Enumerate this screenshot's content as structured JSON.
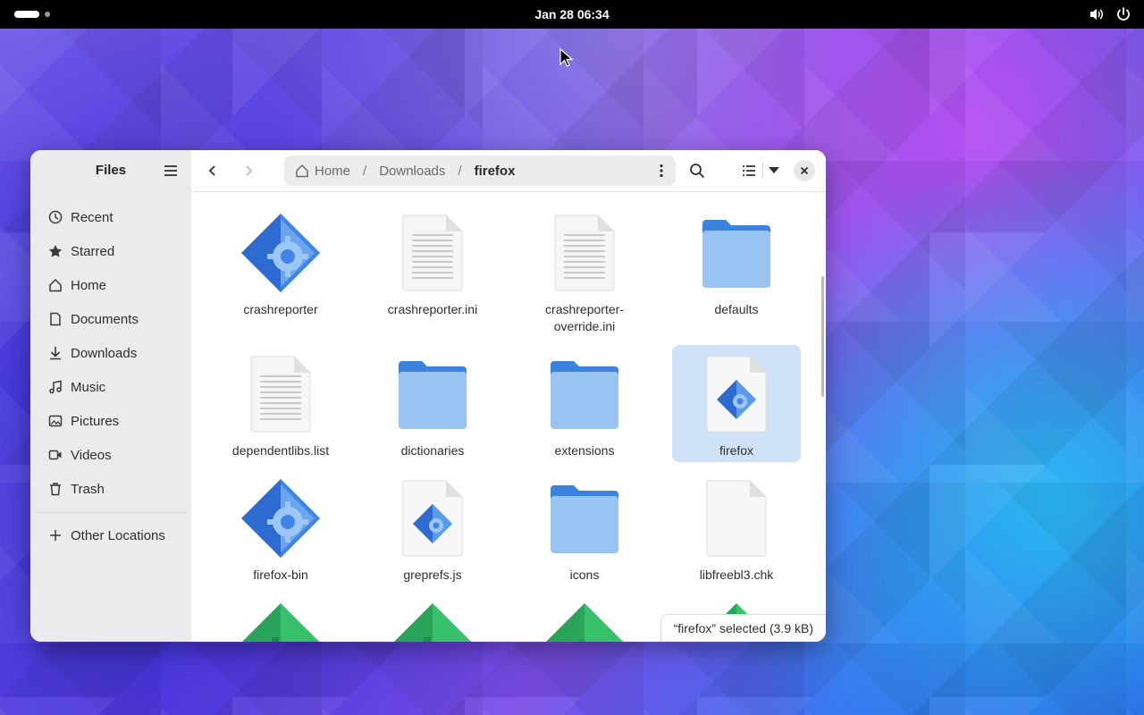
{
  "topbar": {
    "clock": "Jan 28  06:34"
  },
  "window": {
    "sidebar": {
      "title": "Files",
      "places": [
        {
          "label": "Recent",
          "icon": "clock-icon"
        },
        {
          "label": "Starred",
          "icon": "star-icon"
        },
        {
          "label": "Home",
          "icon": "home-icon"
        },
        {
          "label": "Documents",
          "icon": "document-icon"
        },
        {
          "label": "Downloads",
          "icon": "download-icon"
        },
        {
          "label": "Music",
          "icon": "music-icon"
        },
        {
          "label": "Pictures",
          "icon": "picture-icon"
        },
        {
          "label": "Videos",
          "icon": "video-icon"
        },
        {
          "label": "Trash",
          "icon": "trash-icon"
        }
      ],
      "other_locations": "Other Locations"
    },
    "pathbar": {
      "crumbs": [
        "Home",
        "Downloads",
        "firefox"
      ]
    },
    "files": [
      {
        "name": "crashreporter",
        "type": "executable"
      },
      {
        "name": "crashreporter.ini",
        "type": "text"
      },
      {
        "name": "crashreporter-override.ini",
        "type": "text"
      },
      {
        "name": "defaults",
        "type": "folder"
      },
      {
        "name": "dependentlibs.list",
        "type": "text"
      },
      {
        "name": "dictionaries",
        "type": "folder"
      },
      {
        "name": "extensions",
        "type": "folder"
      },
      {
        "name": "firefox",
        "type": "script",
        "selected": true
      },
      {
        "name": "firefox-bin",
        "type": "executable"
      },
      {
        "name": "greprefs.js",
        "type": "script"
      },
      {
        "name": "icons",
        "type": "folder"
      },
      {
        "name": "libfreebl3.chk",
        "type": "blank"
      }
    ],
    "status": {
      "text": "“firefox” selected  (3.9 kB)"
    }
  },
  "colors": {
    "accent": "#3584e4",
    "folder": "#8fbcf0",
    "selection": "#d0e2f8",
    "library": "#2aa45a"
  }
}
